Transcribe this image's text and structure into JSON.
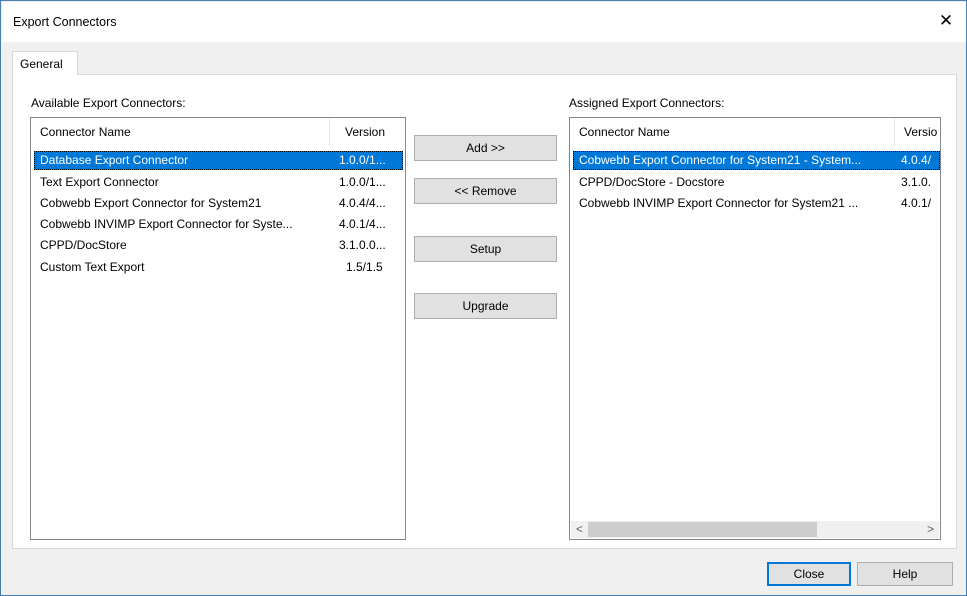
{
  "window": {
    "title": "Export Connectors"
  },
  "tabs": [
    {
      "label": "General"
    }
  ],
  "available": {
    "label": "Available Export Connectors:",
    "columns": {
      "name": "Connector Name",
      "version": "Version"
    },
    "rows": [
      {
        "name": "Database Export Connector",
        "version": "1.0.0/1...",
        "selected": true
      },
      {
        "name": "Text Export Connector",
        "version": "1.0.0/1..."
      },
      {
        "name": "Cobwebb Export Connector for System21",
        "version": "4.0.4/4..."
      },
      {
        "name": "Cobwebb INVIMP Export Connector for Syste...",
        "version": "4.0.1/4..."
      },
      {
        "name": "CPPD/DocStore",
        "version": "3.1.0.0..."
      },
      {
        "name": "Custom Text Export",
        "version": "1.5/1.5"
      }
    ]
  },
  "assigned": {
    "label": "Assigned Export Connectors:",
    "columns": {
      "name": "Connector Name",
      "version": "Versio"
    },
    "rows": [
      {
        "name": "Cobwebb Export Connector for System21 - System...",
        "version": "4.0.4/",
        "selected": true
      },
      {
        "name": "CPPD/DocStore - Docstore",
        "version": "3.1.0."
      },
      {
        "name": "Cobwebb INVIMP Export Connector for System21 ...",
        "version": "4.0.1/"
      }
    ],
    "scroll_left": "<",
    "scroll_right": ">"
  },
  "actions": {
    "add": "Add >>",
    "remove": "<< Remove",
    "setup": "Setup",
    "upgrade": "Upgrade"
  },
  "footer": {
    "close": "Close",
    "help": "Help"
  },
  "icons": {
    "window_close": "close-icon"
  },
  "colors": {
    "selection": "#0078d7",
    "accent_border": "#0078d7"
  }
}
